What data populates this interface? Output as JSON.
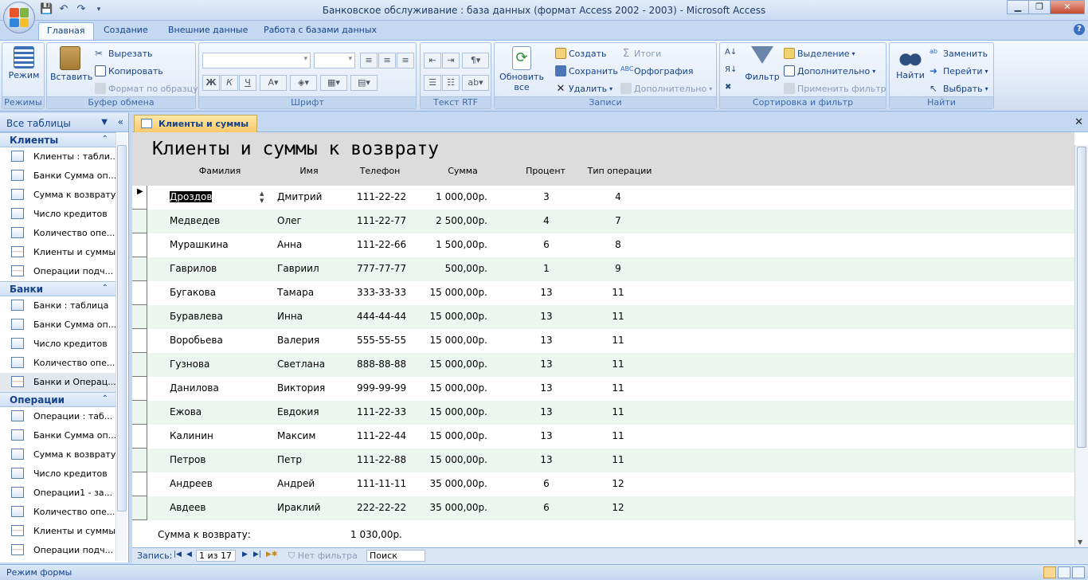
{
  "window": {
    "title": "Банковское обслуживание : база данных (формат Access 2002 - 2003) - Microsoft Access"
  },
  "ribbon_tabs": [
    "Главная",
    "Создание",
    "Внешние данные",
    "Работа с базами данных"
  ],
  "ribbon": {
    "modes": {
      "label": "Режимы",
      "view_label": "Режим"
    },
    "clipboard": {
      "label": "Буфер обмена",
      "paste": "Вставить",
      "cut": "Вырезать",
      "copy": "Копировать",
      "format_painter": "Формат по образцу"
    },
    "font": {
      "label": "Шрифт"
    },
    "rtf": {
      "label": "Текст RTF"
    },
    "records": {
      "label": "Записи",
      "refresh": "Обновить все",
      "create": "Создать",
      "save": "Сохранить",
      "delete": "Удалить",
      "totals": "Итоги",
      "spelling": "Орфография",
      "more": "Дополнительно"
    },
    "sort_filter": {
      "label": "Сортировка и фильтр",
      "filter": "Фильтр",
      "selection": "Выделение",
      "advanced": "Дополнительно",
      "apply_filter": "Применить фильтр"
    },
    "find": {
      "label": "Найти",
      "find": "Найти",
      "replace": "Заменить",
      "goto": "Перейти",
      "select": "Выбрать"
    }
  },
  "nav_pane": {
    "header": "Все таблицы",
    "sections": [
      {
        "title": "Клиенты",
        "items": [
          {
            "label": "Клиенты : табли...",
            "type": "table"
          },
          {
            "label": "Банки Сумма оп...",
            "type": "query"
          },
          {
            "label": "Сумма к возврату",
            "type": "query"
          },
          {
            "label": "Число кредитов",
            "type": "query"
          },
          {
            "label": "Количество опе...",
            "type": "table"
          },
          {
            "label": "Клиенты и суммы",
            "type": "form"
          },
          {
            "label": "Операции подч...",
            "type": "form"
          }
        ]
      },
      {
        "title": "Банки",
        "items": [
          {
            "label": "Банки : таблица",
            "type": "table"
          },
          {
            "label": "Банки Сумма оп...",
            "type": "query"
          },
          {
            "label": "Число кредитов",
            "type": "query"
          },
          {
            "label": "Количество опе...",
            "type": "table"
          },
          {
            "label": "Банки и Операц...",
            "type": "form",
            "selected": true
          }
        ]
      },
      {
        "title": "Операции",
        "items": [
          {
            "label": "Операции : таб...",
            "type": "table"
          },
          {
            "label": "Банки Сумма оп...",
            "type": "query"
          },
          {
            "label": "Сумма к возврату",
            "type": "query"
          },
          {
            "label": "Число кредитов",
            "type": "query"
          },
          {
            "label": "Операции1 - за...",
            "type": "query"
          },
          {
            "label": "Количество опе...",
            "type": "table"
          },
          {
            "label": "Клиенты и суммы",
            "type": "form"
          },
          {
            "label": "Операции подч...",
            "type": "form"
          }
        ]
      }
    ]
  },
  "document": {
    "tab_label": "Клиенты и суммы",
    "form_title": "Клиенты и суммы к возврату",
    "columns": [
      "Фамилия",
      "Имя",
      "Телефон",
      "Сумма",
      "Процент",
      "Тип  операции"
    ],
    "rows": [
      [
        "Дроздов",
        "Дмитрий",
        "111-22-22",
        "1 000,00р.",
        "3",
        "4"
      ],
      [
        "Медведев",
        "Олег",
        "111-22-77",
        "2 500,00р.",
        "4",
        "7"
      ],
      [
        "Мурашкина",
        "Анна",
        "111-22-66",
        "1 500,00р.",
        "6",
        "8"
      ],
      [
        "Гаврилов",
        "Гавриил",
        "777-77-77",
        "500,00р.",
        "1",
        "9"
      ],
      [
        "Бугакова",
        "Тамара",
        "333-33-33",
        "15 000,00р.",
        "13",
        "11"
      ],
      [
        "Буравлева",
        "Инна",
        "444-44-44",
        "15 000,00р.",
        "13",
        "11"
      ],
      [
        "Воробьева",
        "Валерия",
        "555-55-55",
        "15 000,00р.",
        "13",
        "11"
      ],
      [
        "Гузнова",
        "Светлана",
        "888-88-88",
        "15 000,00р.",
        "13",
        "11"
      ],
      [
        "Данилова",
        "Виктория",
        "999-99-99",
        "15 000,00р.",
        "13",
        "11"
      ],
      [
        "Ежова",
        "Евдокия",
        "111-22-33",
        "15 000,00р.",
        "13",
        "11"
      ],
      [
        "Калинин",
        "Максим",
        "111-22-44",
        "15 000,00р.",
        "13",
        "11"
      ],
      [
        "Петров",
        "Петр",
        "111-22-88",
        "15 000,00р.",
        "13",
        "11"
      ],
      [
        "Андреев",
        "Андрей",
        "111-11-11",
        "35 000,00р.",
        "6",
        "12"
      ],
      [
        "Авдеев",
        "Ираклий",
        "222-22-22",
        "35 000,00р.",
        "6",
        "12"
      ]
    ],
    "footer_label": "Сумма к возврату:",
    "footer_value": "1 030,00р."
  },
  "record_nav": {
    "label": "Запись:",
    "position": "1 из 17",
    "filter": "Нет фильтра",
    "search": "Поиск"
  },
  "status": {
    "text": "Режим формы"
  }
}
